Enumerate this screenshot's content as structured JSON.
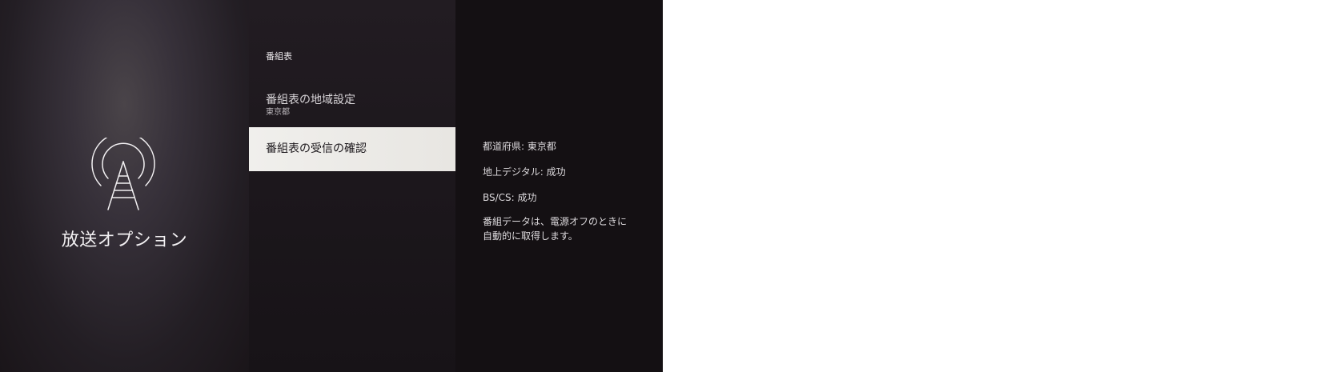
{
  "app": {
    "section_title": "放送オプション",
    "section_icon": "broadcast-antenna-icon"
  },
  "menu": {
    "header": "番組表",
    "items": [
      {
        "label": "番組表の地域設定",
        "value": "東京都",
        "selected": false
      },
      {
        "label": "番組表の受信の確認",
        "selected": true
      }
    ]
  },
  "details": {
    "prefecture": "都道府県: 東京都",
    "terrestrial": "地上デジタル: 成功",
    "bs_cs": "BS/CS: 成功",
    "note": "番組データは、電源オフのときに自動的に取得します。"
  },
  "colors": {
    "selected_item_background": "#ebe9e5",
    "panel_background": "#1c171c",
    "text": "#e8e6e8"
  }
}
